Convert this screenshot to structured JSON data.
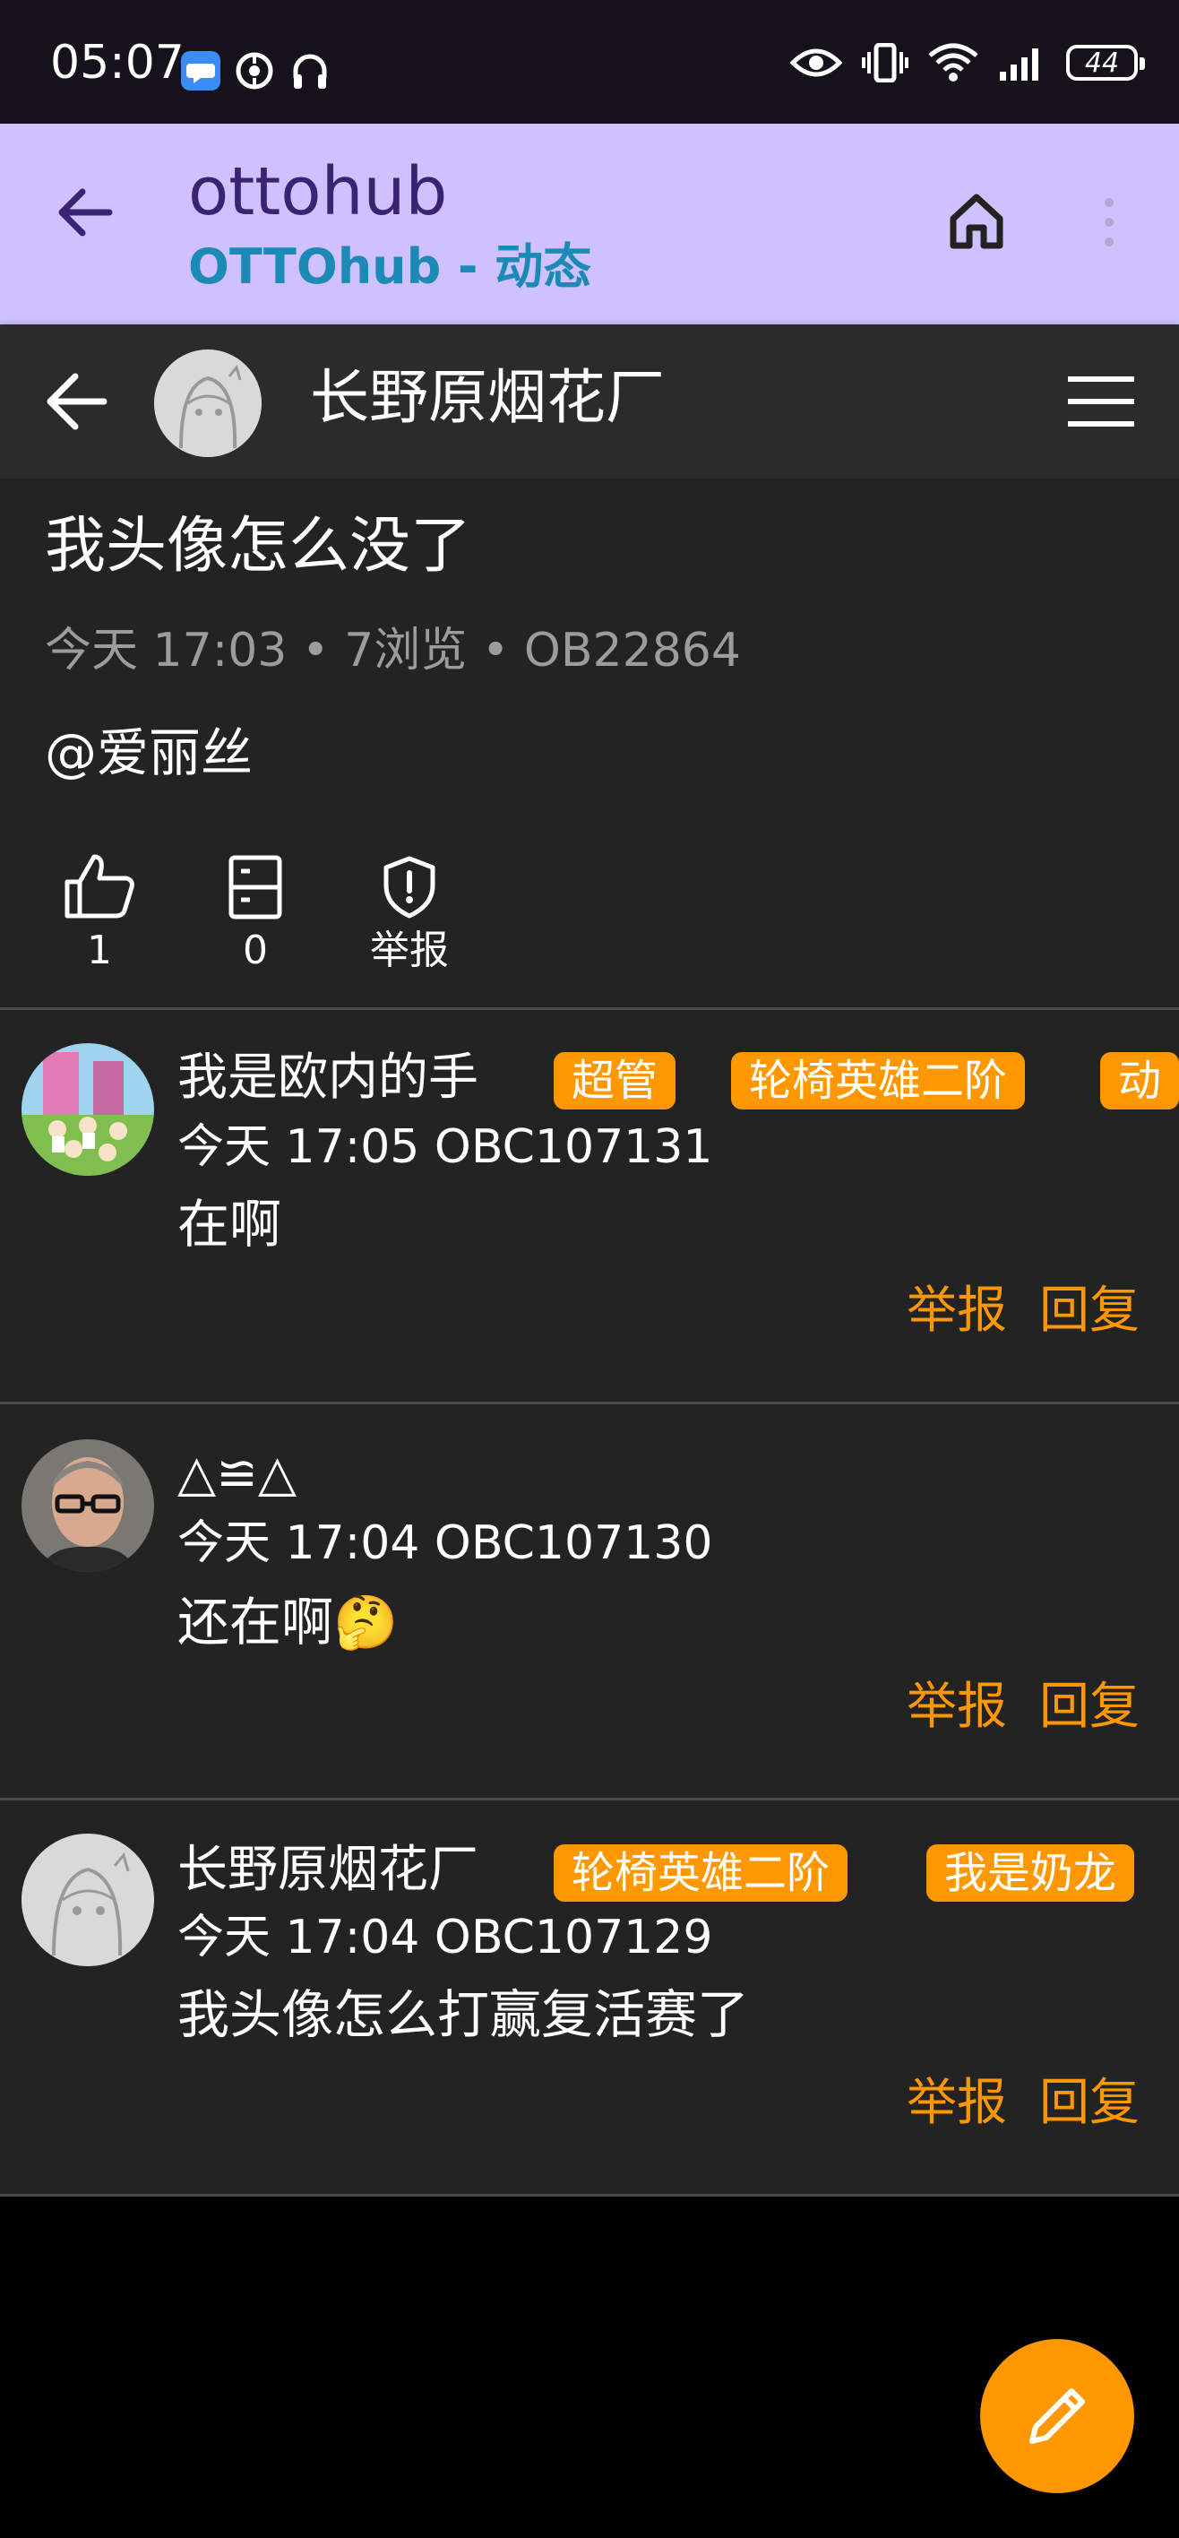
{
  "status_bar": {
    "time": "05:07",
    "battery": "44",
    "icons": [
      "chat-app-icon",
      "messenger-icon",
      "headphones-icon",
      "eye-icon",
      "vibrate-icon",
      "wifi-icon",
      "signal-icon"
    ]
  },
  "app_bar": {
    "title": "ottohub",
    "subtitle": "OTTOhub - 动态",
    "colors": {
      "background": "#cfc0fe",
      "title": "#3a2373",
      "subtitle": "#1b8ab7"
    }
  },
  "web_header": {
    "title": "长野原烟花厂"
  },
  "post": {
    "title": "我头像怎么没了",
    "meta": "今天 17:03 • 7浏览 • OB22864",
    "body": "@爱丽丝",
    "actions": [
      {
        "icon": "thumbs-up-icon",
        "label": "1"
      },
      {
        "icon": "favorite-box-icon",
        "label": "0"
      },
      {
        "icon": "shield-report-icon",
        "label": "举报"
      }
    ]
  },
  "comments": [
    {
      "name": "我是欧内的手",
      "badges": [
        "超管",
        "轮椅英雄二阶",
        "动"
      ],
      "meta": "今天 17:05 OBC107131",
      "text": "在啊",
      "report": "举报",
      "reply": "回复"
    },
    {
      "name": "△≌△",
      "badges": [],
      "meta": "今天 17:04 OBC107130",
      "text": "还在啊🤔",
      "report": "举报",
      "reply": "回复"
    },
    {
      "name": "长野原烟花厂",
      "badges": [
        "轮椅英雄二阶",
        "我是奶龙"
      ],
      "meta": "今天 17:04 OBC107129",
      "text": "我头像怎么打赢复活赛了",
      "report": "举报",
      "reply": "回复"
    }
  ],
  "accent_color": "#ff9800"
}
